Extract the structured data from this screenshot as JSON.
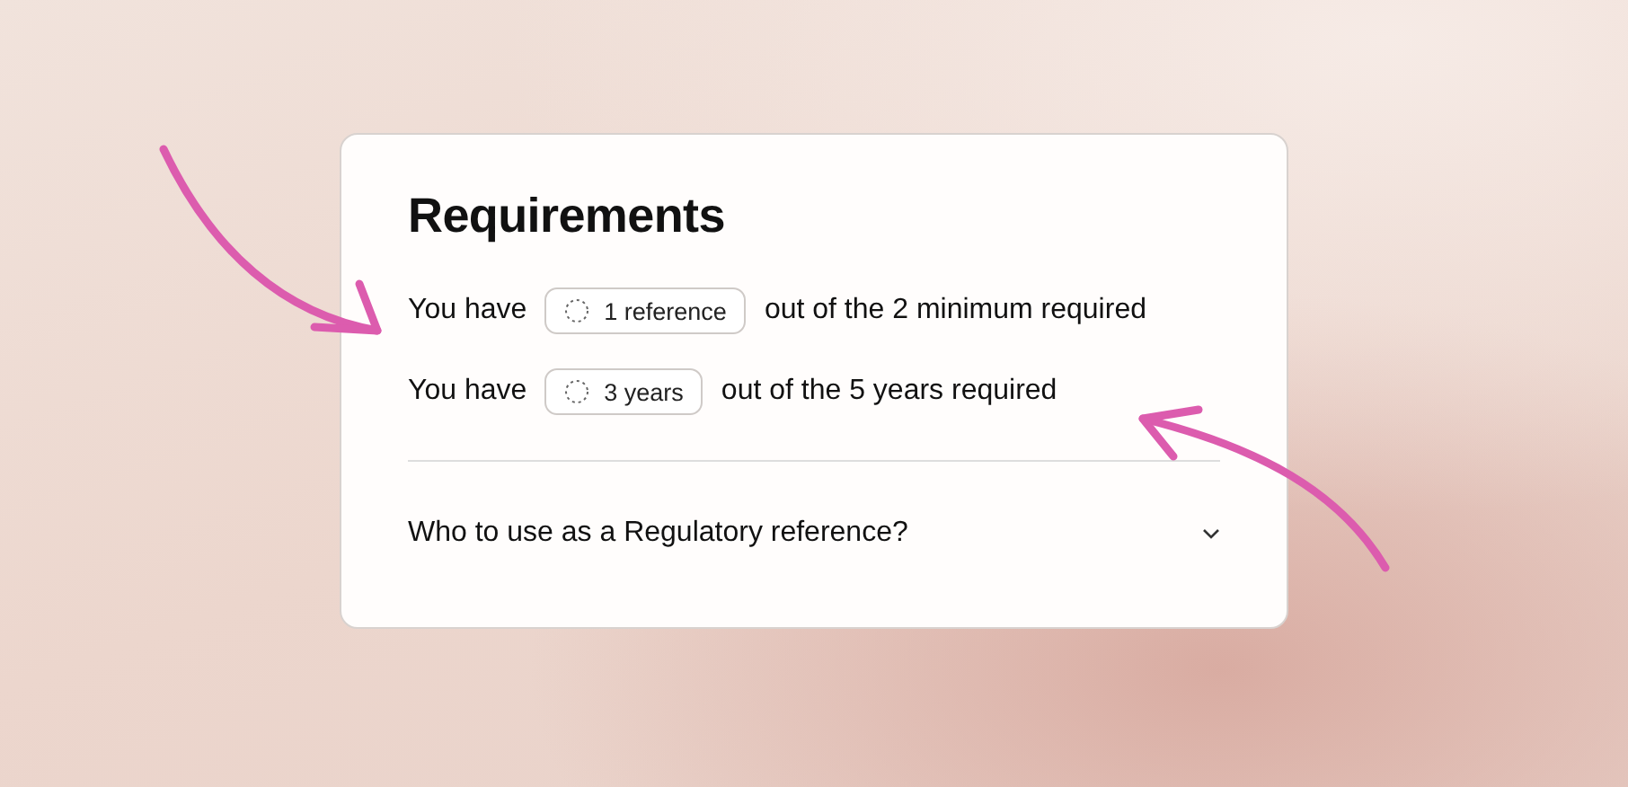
{
  "card": {
    "title": "Requirements",
    "requirements": [
      {
        "prefix": "You have",
        "badge": "1 reference",
        "suffix": "out of the 2 minimum required"
      },
      {
        "prefix": "You have",
        "badge": "3 years",
        "suffix": "out of the 5 years required"
      }
    ],
    "accordion": {
      "question": "Who to use as a Regulatory reference?",
      "expanded": false
    }
  }
}
